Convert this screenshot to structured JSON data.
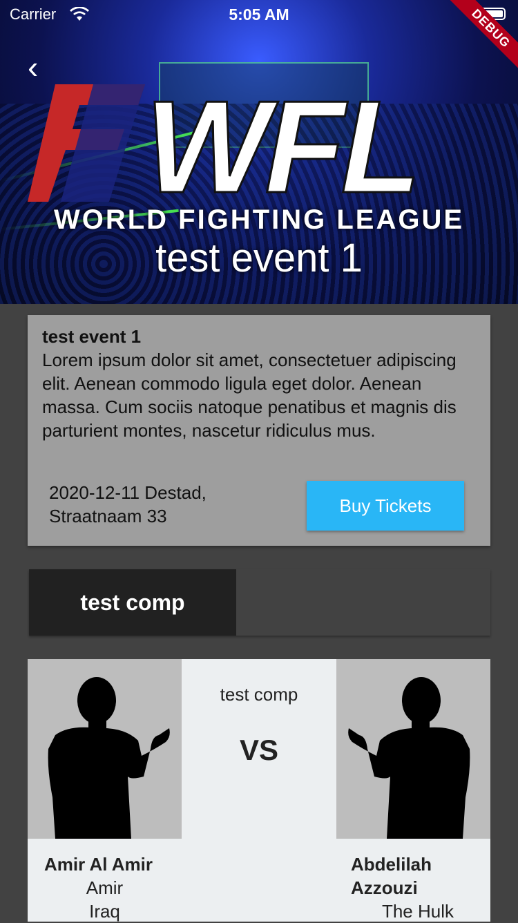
{
  "status_bar": {
    "carrier": "Carrier",
    "time": "5:05 AM"
  },
  "debug_banner": "DEBUG",
  "header": {
    "logo_text": "WFL",
    "league_name": "WORLD FIGHTING LEAGUE",
    "event_title": "test event 1"
  },
  "event_card": {
    "title": "test event 1",
    "description": "Lorem ipsum dolor sit amet, consectetuer adipiscing elit. Aenean commodo ligula eget dolor. Aenean massa. Cum sociis natoque penatibus et magnis dis parturient montes, nascetur ridiculus mus.",
    "date_line1": "2020-12-11 Destad,",
    "date_line2": "Straatnaam 33",
    "buy_label": "Buy Tickets"
  },
  "tabs": [
    {
      "label": "test comp"
    }
  ],
  "match": {
    "competition": "test comp",
    "vs_label": "VS",
    "fighter_left": {
      "name": "Amir Al Amir",
      "nickname": "Amir",
      "country": "Iraq"
    },
    "fighter_right": {
      "name_line1": "Abdelilah",
      "name_line2": "Azzouzi",
      "nickname": "The Hulk"
    }
  },
  "colors": {
    "accent": "#29b6f6",
    "background": "#424242",
    "card": "#9e9e9e",
    "tab_active": "#212121",
    "logo_red": "#c62828",
    "logo_blue": "#1a237e"
  }
}
